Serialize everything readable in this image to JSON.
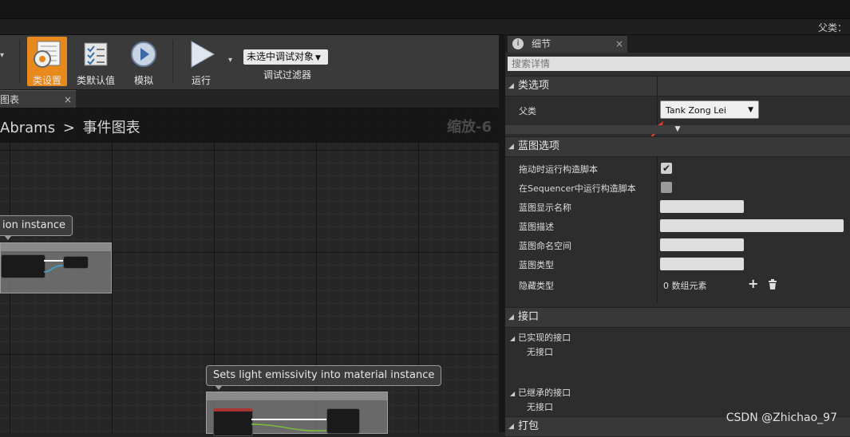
{
  "topbar": {
    "parent_class": "父类："
  },
  "toolbar": {
    "class_settings": "类设置",
    "class_defaults": "类默认值",
    "simulate": "模拟",
    "run": "运行",
    "debug_object": "未选中调试对象",
    "debug_filter": "调试过滤器"
  },
  "graph": {
    "tab_label": "图表",
    "tab_close": "×",
    "breadcrumb_parent": "Abrams",
    "breadcrumb_separator": ">",
    "breadcrumb_current": "事件图表",
    "zoom": "缩放-6",
    "comment_1": "ion instance",
    "comment_2": "Sets light emissivity into material instance"
  },
  "details": {
    "tab_title": "细节",
    "tab_close": "×",
    "search_placeholder": "搜索详情",
    "class_options": {
      "header": "类选项",
      "parent_class_label": "父类",
      "parent_class_value": "Tank Zong Lei"
    },
    "blueprint_options": {
      "header": "蓝图选项",
      "run_construction_on_drag": "拖动时运行构造脚本",
      "run_construction_in_sequencer": "在Sequencer中运行构造脚本",
      "display_name": "蓝图显示名称",
      "description": "蓝图描述",
      "namespace": "蓝图命名空间",
      "type": "蓝图类型",
      "hide_categories": "隐藏类型",
      "hide_categories_value": "0 数组元素",
      "run_on_drag_checked": true,
      "run_in_sequencer_checked": false
    },
    "interfaces": {
      "header": "接口",
      "implemented": "已实现的接口",
      "implemented_none": "无接口",
      "inherited": "已继承的接口",
      "inherited_none": "无接口"
    },
    "packaging": {
      "header": "打包"
    }
  },
  "watermark": "CSDN @Zhichao_97",
  "colors": {
    "accent": "#e8891e",
    "annotation_arrow": "#e03a2a"
  }
}
